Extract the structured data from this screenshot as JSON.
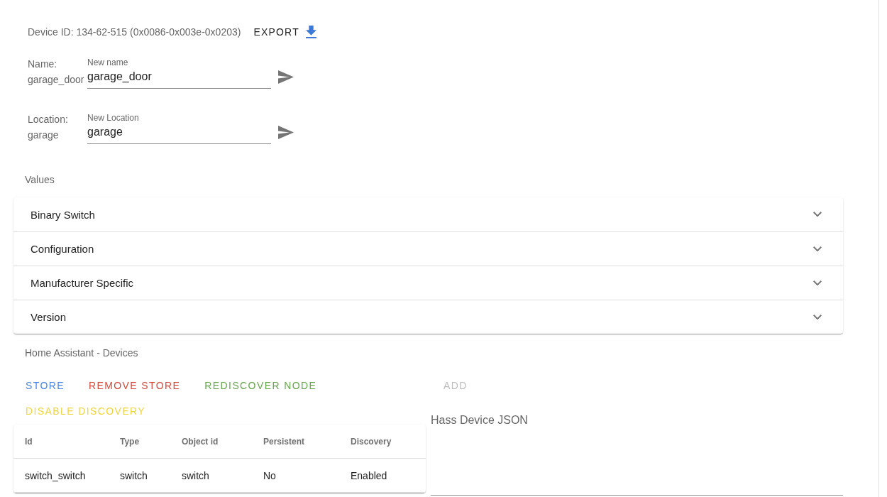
{
  "device": {
    "id_text": "Device ID: 134-62-515 (0x0086-0x003e-0x0203)",
    "export_label": "EXPORT"
  },
  "properties": [
    {
      "label": "Name:",
      "current": "garage_door",
      "field_label": "New name",
      "value": "garage_door"
    },
    {
      "label": "Location:",
      "current": "garage",
      "field_label": "New Location",
      "value": "garage"
    }
  ],
  "values": {
    "title": "Values",
    "panels": [
      {
        "title": "Binary Switch",
        "expanded": false
      },
      {
        "title": "Configuration",
        "expanded": false
      },
      {
        "title": "Manufacturer Specific",
        "expanded": false
      },
      {
        "title": "Version",
        "expanded": false
      }
    ]
  },
  "home_assistant": {
    "title": "Home Assistant - Devices",
    "buttons": [
      {
        "label": "STORE",
        "color": "#4a86e8",
        "disabled": false
      },
      {
        "label": "REMOVE STORE",
        "color": "#d64a3c",
        "disabled": false
      },
      {
        "label": "REDISCOVER NODE",
        "color": "#67a64c",
        "disabled": false
      },
      {
        "label": "DISABLE DISCOVERY",
        "color": "#f0d43c",
        "disabled": false
      }
    ],
    "add_button": {
      "label": "ADD",
      "disabled": true
    },
    "table": {
      "columns": [
        "Id",
        "Type",
        "Object id",
        "Persistent",
        "Discovery"
      ],
      "rows": [
        [
          "switch_switch",
          "switch",
          "switch",
          "No",
          "Enabled"
        ]
      ]
    },
    "json_field": {
      "placeholder": "Hass Device JSON"
    }
  }
}
